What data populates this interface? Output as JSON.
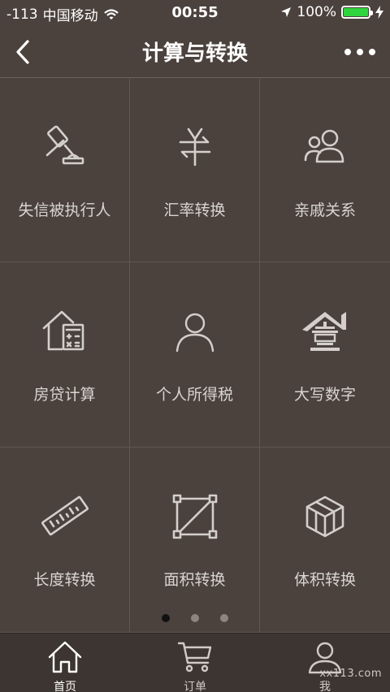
{
  "status_bar": {
    "signal": "-113",
    "carrier": "中国移动",
    "time": "00:55",
    "battery": "100%",
    "battery_color": "#2fd53d"
  },
  "header": {
    "title": "计算与转换",
    "back_icon": "chevron-left-icon",
    "more_icon": "more-dots-icon"
  },
  "grid": [
    {
      "label": "失信被执行人",
      "icon": "gavel-icon"
    },
    {
      "label": "汇率转换",
      "icon": "currency-exchange-icon"
    },
    {
      "label": "亲戚关系",
      "icon": "people-icon"
    },
    {
      "label": "房贷计算",
      "icon": "house-calculator-icon"
    },
    {
      "label": "个人所得税",
      "icon": "person-icon"
    },
    {
      "label": "大写数字",
      "icon": "chinese-numeral-house-icon"
    },
    {
      "label": "长度转换",
      "icon": "ruler-icon"
    },
    {
      "label": "面积转换",
      "icon": "area-square-icon"
    },
    {
      "label": "体积转换",
      "icon": "cube-icon"
    }
  ],
  "pager": {
    "pages": 3,
    "active": 1
  },
  "tabs": [
    {
      "label": "首页",
      "icon": "home-icon",
      "active": true
    },
    {
      "label": "订单",
      "icon": "cart-icon",
      "active": false
    },
    {
      "label": "我",
      "icon": "profile-icon",
      "active": false
    }
  ],
  "watermark": "xx113.com",
  "colors": {
    "background": "#4b423d",
    "tab_bar": "#3d3531",
    "icon_stroke": "#d4cfcb"
  }
}
